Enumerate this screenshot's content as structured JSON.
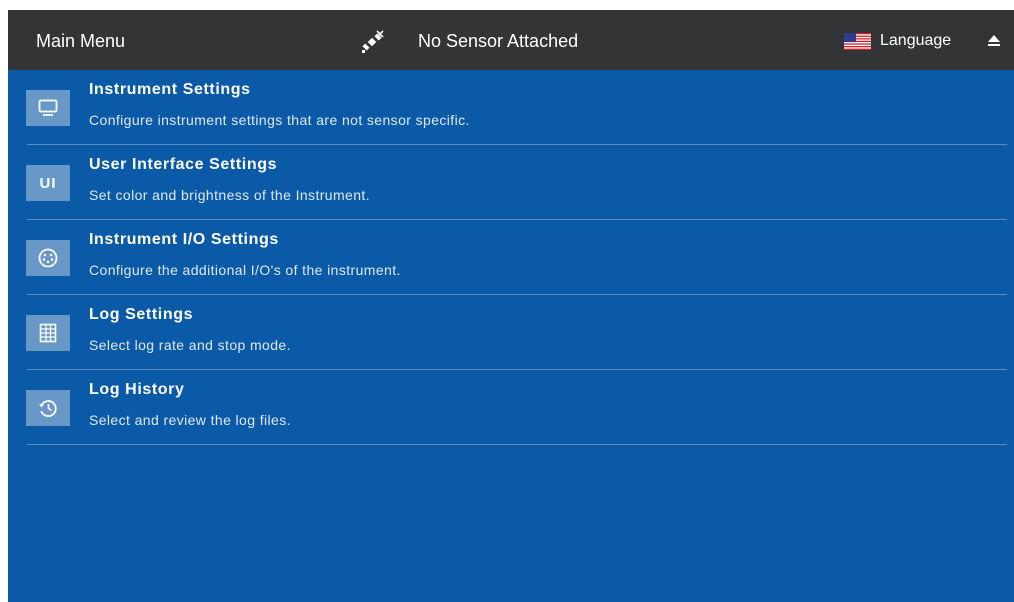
{
  "header": {
    "title": "Main Menu",
    "sensor_icon": "satellite-disconnected-icon",
    "sensor_status": "No Sensor Attached",
    "language_label": "Language",
    "flag_icon": "us-flag-icon",
    "eject_icon": "eject-icon"
  },
  "menu": {
    "items": [
      {
        "icon": "monitor-icon",
        "title": "Instrument Settings",
        "description": "Configure instrument settings that are not sensor specific."
      },
      {
        "icon": "ui-icon",
        "icon_text": "UI",
        "title": "User Interface Settings",
        "description": "Set color and brightness of the Instrument."
      },
      {
        "icon": "connector-port-icon",
        "title": "Instrument I/O Settings",
        "description": "Configure the additional I/O's of the instrument."
      },
      {
        "icon": "log-grid-icon",
        "title": "Log Settings",
        "description": "Select log rate and stop mode."
      },
      {
        "icon": "history-clock-icon",
        "title": "Log History",
        "description": "Select and review the log files."
      }
    ]
  },
  "colors": {
    "header_bg": "#323436",
    "content_bg": "#0b5aa8",
    "icon_tile_bg": "#6898c8",
    "divider": "#5b8cc4",
    "text": "#ffffff"
  }
}
